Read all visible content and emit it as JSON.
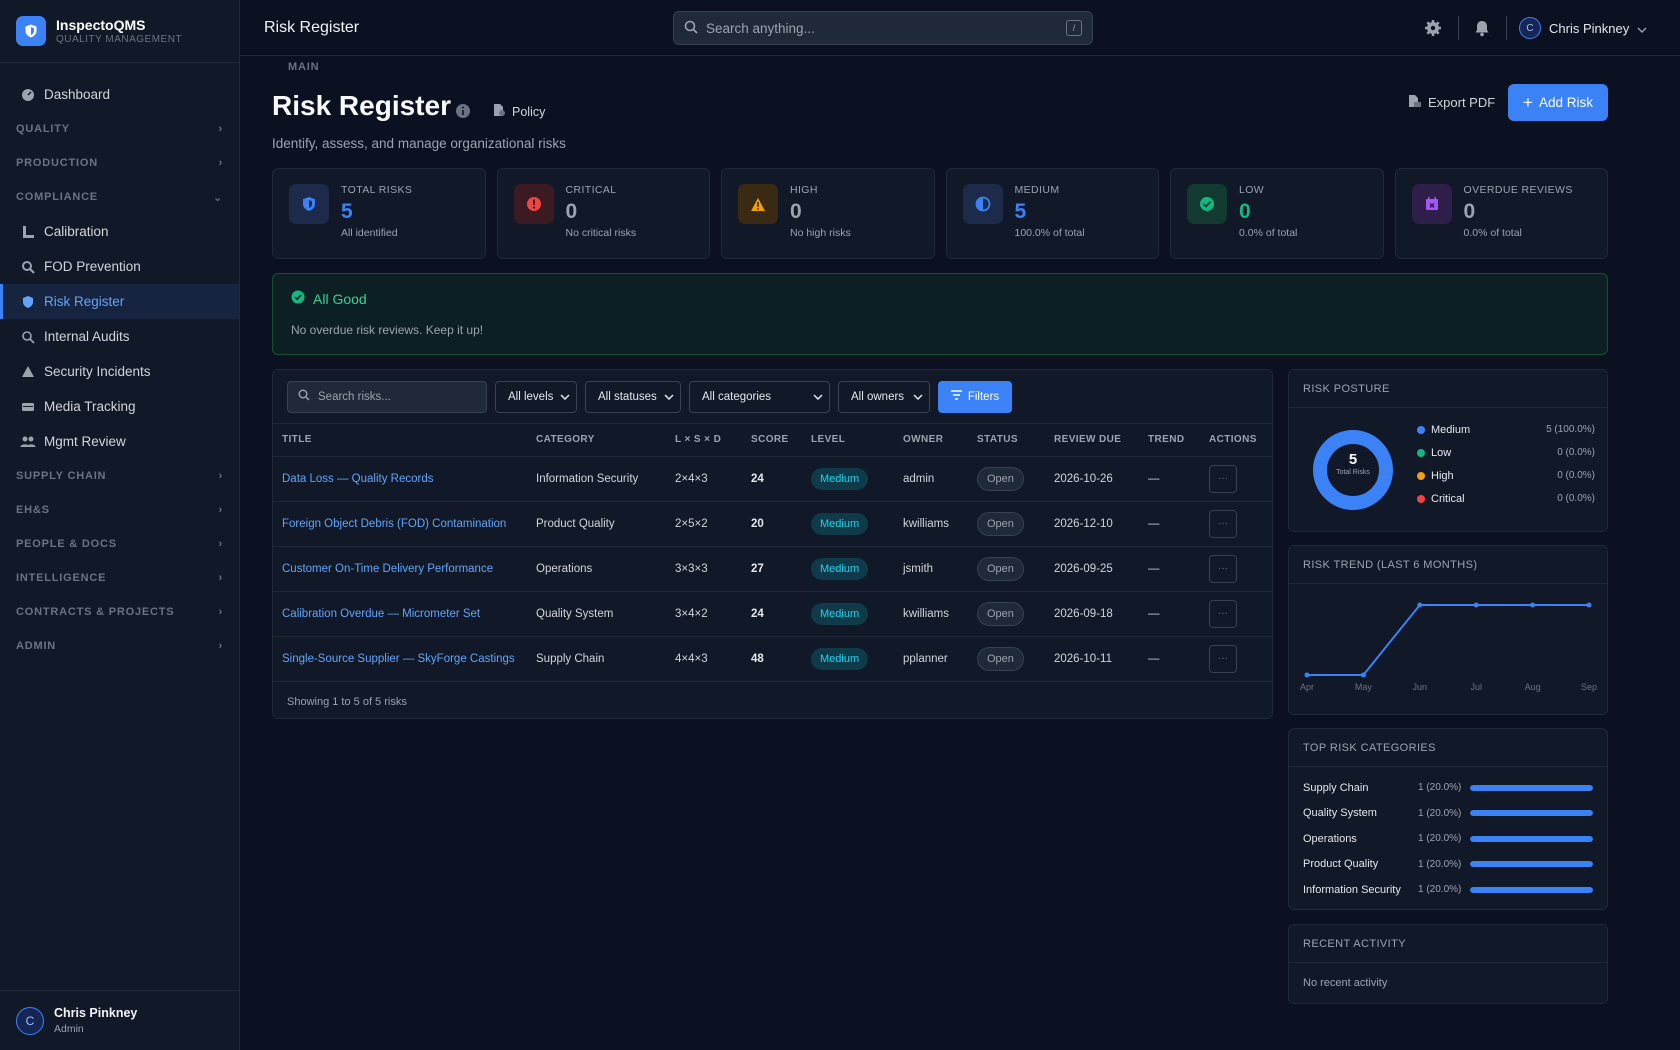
{
  "brand": {
    "name": "InspectoQMS",
    "subtitle": "QUALITY MANAGEMENT"
  },
  "sidebar": {
    "main_label": "MAIN",
    "dashboard": "Dashboard",
    "sections": {
      "quality": "QUALITY",
      "production": "PRODUCTION",
      "compliance": "COMPLIANCE",
      "supply_chain": "SUPPLY CHAIN",
      "ehs": "EH&S",
      "people_docs": "PEOPLE & DOCS",
      "intelligence": "INTELLIGENCE",
      "contracts": "CONTRACTS & PROJECTS",
      "admin": "ADMIN"
    },
    "compliance_items": [
      "Calibration",
      "FOD Prevention",
      "Risk Register",
      "Internal Audits",
      "Security Incidents",
      "Media Tracking",
      "Mgmt Review"
    ],
    "active_item": "Risk Register",
    "user": {
      "initial": "C",
      "name": "Chris Pinkney",
      "role": "Admin"
    }
  },
  "topbar": {
    "title": "Risk Register",
    "search_placeholder": "Search anything...",
    "search_shortcut": "/",
    "user_initial": "C",
    "user_name": "Chris Pinkney"
  },
  "page": {
    "title": "Risk Register",
    "policy_label": "Policy",
    "subtitle": "Identify, assess, and manage organizational risks",
    "export_label": "Export PDF",
    "add_label": "Add Risk"
  },
  "stats": [
    {
      "label": "TOTAL RISKS",
      "value": "5",
      "sub": "All identified",
      "color": "#3b82f6",
      "icon": "shield-icon"
    },
    {
      "label": "CRITICAL",
      "value": "0",
      "sub": "No critical risks",
      "color": "#ef4444",
      "icon": "alert-circle-icon"
    },
    {
      "label": "HIGH",
      "value": "0",
      "sub": "No high risks",
      "color": "#f59e0b",
      "icon": "warning-icon"
    },
    {
      "label": "MEDIUM",
      "value": "5",
      "sub": "100.0% of total",
      "color": "#3b82f6",
      "icon": "half-circle-icon"
    },
    {
      "label": "LOW",
      "value": "0",
      "sub": "0.0% of total",
      "color": "#10b981",
      "icon": "check-circle-icon"
    },
    {
      "label": "OVERDUE REVIEWS",
      "value": "0",
      "sub": "0.0% of total",
      "color": "#a855f7",
      "icon": "calendar-x-icon"
    }
  ],
  "alert": {
    "title": "All Good",
    "text": "No overdue risk reviews. Keep it up!"
  },
  "filters": {
    "search_placeholder": "Search risks...",
    "levels": "All levels",
    "statuses": "All statuses",
    "categories": "All categories",
    "owners": "All owners",
    "filters_btn": "Filters"
  },
  "table": {
    "headers": [
      "TITLE",
      "CATEGORY",
      "L × S × D",
      "SCORE",
      "LEVEL",
      "OWNER",
      "STATUS",
      "REVIEW DUE",
      "TREND",
      "ACTIONS"
    ],
    "rows": [
      {
        "title": "Data Loss — Quality Records",
        "category": "Information Security",
        "lsd": "2×4×3",
        "score": "24",
        "level": "Medium",
        "owner": "admin",
        "status": "Open",
        "due": "2026-10-26",
        "trend": "—"
      },
      {
        "title": "Foreign Object Debris (FOD) Contamination",
        "category": "Product Quality",
        "lsd": "2×5×2",
        "score": "20",
        "level": "Medium",
        "owner": "kwilliams",
        "status": "Open",
        "due": "2026-12-10",
        "trend": "—"
      },
      {
        "title": "Customer On-Time Delivery Performance",
        "category": "Operations",
        "lsd": "3×3×3",
        "score": "27",
        "level": "Medium",
        "owner": "jsmith",
        "status": "Open",
        "due": "2026-09-25",
        "trend": "—"
      },
      {
        "title": "Calibration Overdue — Micrometer Set",
        "category": "Quality System",
        "lsd": "3×4×2",
        "score": "24",
        "level": "Medium",
        "owner": "kwilliams",
        "status": "Open",
        "due": "2026-09-18",
        "trend": "—"
      },
      {
        "title": "Single-Source Supplier — SkyForge Castings",
        "category": "Supply Chain",
        "lsd": "4×4×3",
        "score": "48",
        "level": "Medium",
        "owner": "pplanner",
        "status": "Open",
        "due": "2026-10-11",
        "trend": "—"
      }
    ],
    "footer": "Showing 1 to 5 of 5 risks"
  },
  "posture": {
    "title": "RISK POSTURE",
    "total": "5",
    "total_label": "Total Risks",
    "legend": [
      {
        "name": "Medium",
        "value": "5 (100.0%)",
        "color": "#3b82f6"
      },
      {
        "name": "Low",
        "value": "0 (0.0%)",
        "color": "#10b981"
      },
      {
        "name": "High",
        "value": "0 (0.0%)",
        "color": "#f59e0b"
      },
      {
        "name": "Critical",
        "value": "0 (0.0%)",
        "color": "#ef4444"
      }
    ]
  },
  "trend": {
    "title": "RISK TREND (LAST 6 MONTHS)"
  },
  "chart_data": {
    "type": "line",
    "x": [
      "Apr",
      "May",
      "Jun",
      "Jul",
      "Aug",
      "Sep"
    ],
    "series": [
      {
        "values": [
          0,
          0,
          5,
          5,
          5,
          5
        ]
      }
    ],
    "color": "#3b82f6"
  },
  "categories_panel": {
    "title": "TOP RISK CATEGORIES",
    "items": [
      {
        "name": "Supply Chain",
        "value": "1 (20.0%)",
        "fraction": 1
      },
      {
        "name": "Quality System",
        "value": "1 (20.0%)",
        "fraction": 1
      },
      {
        "name": "Operations",
        "value": "1 (20.0%)",
        "fraction": 1
      },
      {
        "name": "Product Quality",
        "value": "1 (20.0%)",
        "fraction": 1
      },
      {
        "name": "Information Security",
        "value": "1 (20.0%)",
        "fraction": 1
      }
    ]
  },
  "recent": {
    "title": "RECENT ACTIVITY",
    "empty": "No recent activity"
  }
}
